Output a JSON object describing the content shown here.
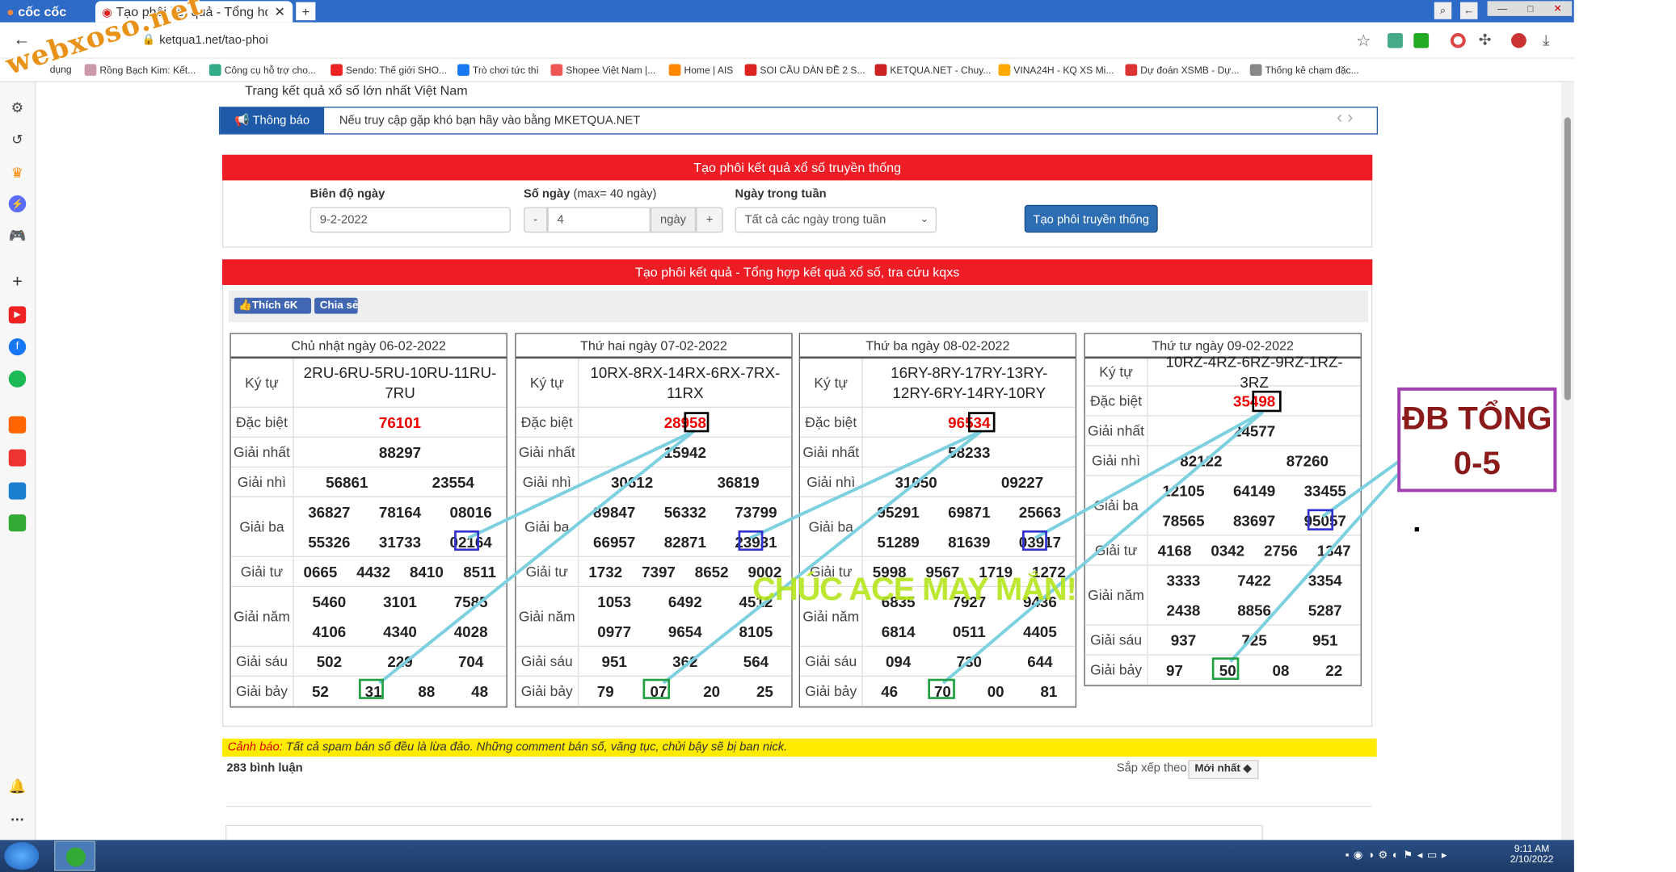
{
  "browser": {
    "brand": "cốc cốc",
    "active_tab_title": "Tạo phôi kết quả - Tổng hợp",
    "url": "ketqua1.net/tao-phoi",
    "watermark": "webxoso.net",
    "bookmarks": [
      {
        "label": "dụng"
      },
      {
        "label": "Rồng Bạch Kim: Kết..."
      },
      {
        "label": "Công cụ hỗ trợ cho..."
      },
      {
        "label": "Sendo: Thế giới SHO..."
      },
      {
        "label": "Trò chơi tức thì"
      },
      {
        "label": "Shopee Việt Nam |..."
      },
      {
        "label": "Home | AIS"
      },
      {
        "label": "SOI CẦU DÀN ĐỀ 2 S..."
      },
      {
        "label": "KETQUA.NET - Chuy..."
      },
      {
        "label": "VINA24H - KQ XS Mi..."
      },
      {
        "label": "Dự đoán XSMB - Dự..."
      },
      {
        "label": "Thống kê chạm đặc..."
      }
    ],
    "clock_time": "9:11 AM",
    "clock_date": "2/10/2022"
  },
  "site": {
    "tagline": "Trang kết quả xổ số lớn nhất Việt Nam",
    "notice_label": "Thông báo",
    "notice_text": "Nếu truy cập gặp khó bạn hãy vào bằng MKETQUA.NET"
  },
  "form": {
    "title": "Tạo phôi kết quả xổ số truyền thống",
    "date_label": "Biên độ ngày",
    "date_value": "9-2-2022",
    "days_label": "Số ngày",
    "days_hint": "(max= 40 ngày)",
    "minus": "-",
    "days_value": "4",
    "days_unit": "ngày",
    "plus": "+",
    "weekday_label": "Ngày trong tuần",
    "weekday_value": "Tất cả các ngày trong tuần",
    "submit": "Tạo phôi truyền thống"
  },
  "results_title": "Tạo phôi kết quả - Tổng hợp kết quả xổ số, tra cứu kqxs",
  "social": {
    "like": "Thích 6K",
    "share": "Chia sẻ"
  },
  "labels": {
    "kytu": "Ký tự",
    "db": "Đặc biệt",
    "g1": "Giải nhất",
    "g2": "Giải nhì",
    "g3": "Giải ba",
    "g4": "Giải tư",
    "g5": "Giải năm",
    "g6": "Giải sáu",
    "g7": "Giải bảy"
  },
  "days": [
    {
      "title": "Chủ nhật ngày 06-02-2022",
      "kytu": "2RU-6RU-5RU-10RU-11RU-7RU",
      "db": "76101",
      "g1": "88297",
      "g2": [
        "56861",
        "23554"
      ],
      "g3": [
        "36827",
        "78164",
        "08016",
        "55326",
        "31733",
        "02164"
      ],
      "g4": [
        "0665",
        "4432",
        "8410",
        "8511"
      ],
      "g5": [
        "5460",
        "3101",
        "7585",
        "4106",
        "4340",
        "4028"
      ],
      "g6": [
        "502",
        "229",
        "704"
      ],
      "g7": [
        "52",
        "31",
        "88",
        "48"
      ]
    },
    {
      "title": "Thứ hai ngày 07-02-2022",
      "kytu": "10RX-8RX-14RX-6RX-7RX-11RX",
      "db": "28958",
      "g1": "15942",
      "g2": [
        "30612",
        "36819"
      ],
      "g3": [
        "89847",
        "56332",
        "73799",
        "66957",
        "82871",
        "23931"
      ],
      "g4": [
        "1732",
        "7397",
        "8652",
        "9002"
      ],
      "g5": [
        "1053",
        "6492",
        "4512",
        "0977",
        "9654",
        "8105"
      ],
      "g6": [
        "951",
        "362",
        "564"
      ],
      "g7": [
        "79",
        "07",
        "20",
        "25"
      ]
    },
    {
      "title": "Thứ ba ngày 08-02-2022",
      "kytu": "16RY-8RY-17RY-13RY-12RY-6RY-14RY-10RY",
      "db": "96534",
      "g1": "58233",
      "g2": [
        "31050",
        "09227"
      ],
      "g3": [
        "95291",
        "69871",
        "25663",
        "51289",
        "81639",
        "03917"
      ],
      "g4": [
        "5998",
        "9567",
        "1719",
        "1272"
      ],
      "g5": [
        "6835",
        "7927",
        "9436",
        "6814",
        "0511",
        "4405"
      ],
      "g6": [
        "094",
        "730",
        "644"
      ],
      "g7": [
        "46",
        "70",
        "00",
        "81"
      ]
    },
    {
      "title": "Thứ tư ngày 09-02-2022",
      "kytu": "10RZ-4RZ-6RZ-9RZ-1RZ-3RZ",
      "db": "35498",
      "g1": "24577",
      "g2": [
        "82122",
        "87260"
      ],
      "g3": [
        "12105",
        "64149",
        "33455",
        "78565",
        "83697",
        "95057"
      ],
      "g4": [
        "4168",
        "0342",
        "2756",
        "1347"
      ],
      "g5": [
        "3333",
        "7422",
        "3354",
        "2438",
        "8856",
        "5287"
      ],
      "g6": [
        "937",
        "725",
        "951"
      ],
      "g7": [
        "97",
        "50",
        "08",
        "22"
      ]
    }
  ],
  "annotation": {
    "box_line1": "ĐB TỔNG",
    "box_line2": "0-5",
    "greeting": "CHÚC ACE MAY MẮN!"
  },
  "comments": {
    "warning_prefix": "Cảnh báo:",
    "warning_text": "Tất cả spam bán số đều là lừa đảo. Những comment bán số, văng tục, chửi bậy sẽ bị ban nick.",
    "count": "283 bình luận",
    "sort_label": "Sắp xếp theo",
    "sort_value": "Mới nhất ◆"
  },
  "colors": {
    "accent_red": "#ee1c25",
    "notice_blue": "#1e5aa8",
    "line_cyan": "#7dd0e0",
    "box_purple": "#a040b0",
    "highlight_blue": "#3030d0",
    "highlight_green": "#20a040"
  }
}
